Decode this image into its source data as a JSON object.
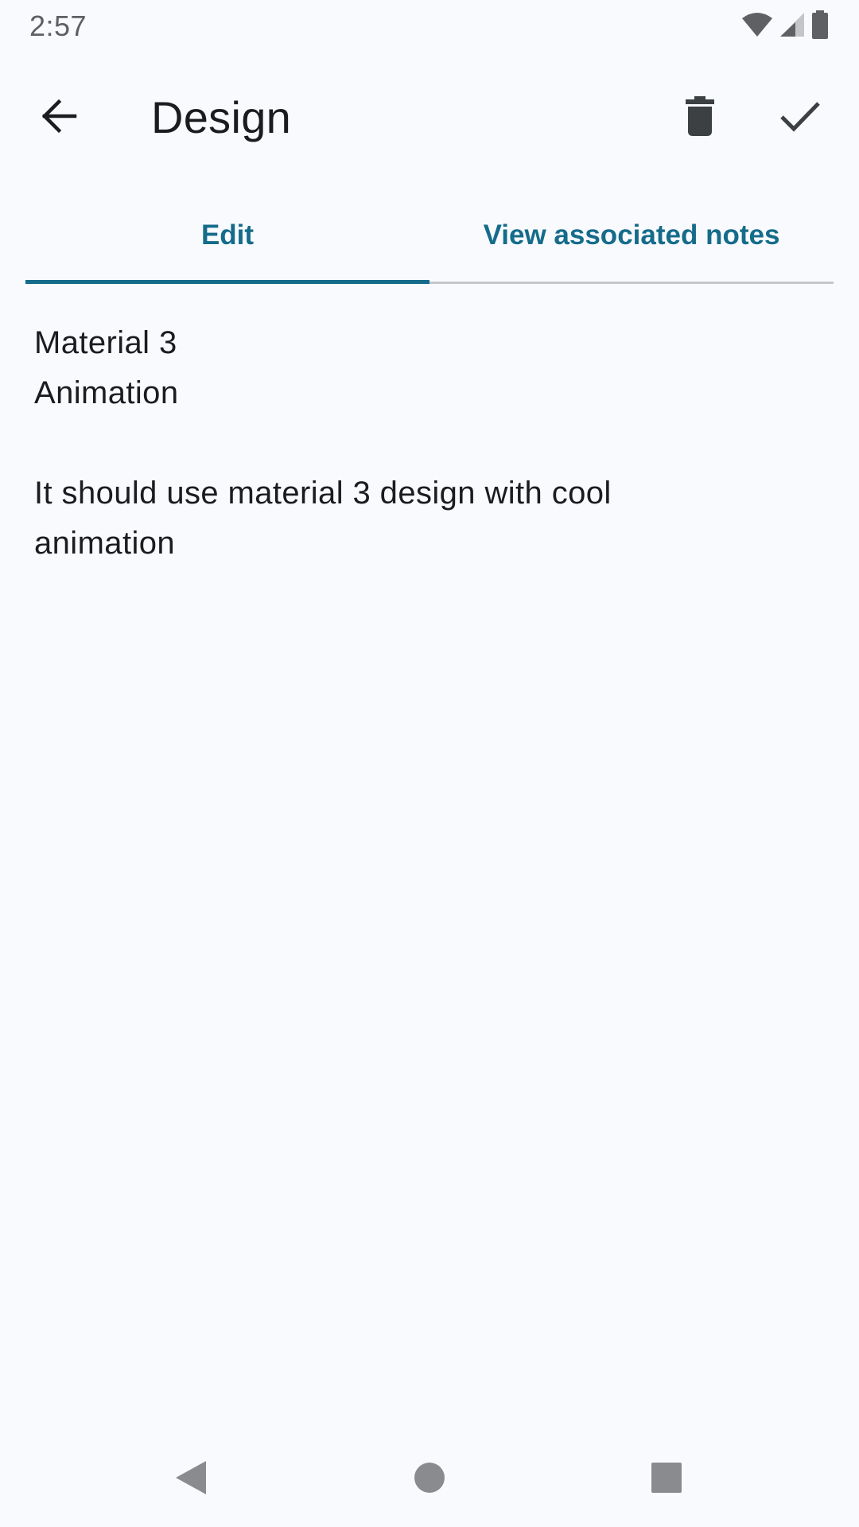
{
  "status_bar": {
    "time": "2:57",
    "icons": [
      "wifi-icon",
      "signal-icon",
      "battery-icon"
    ]
  },
  "app_bar": {
    "title": "Design",
    "back_icon": "arrow-left-icon",
    "delete_icon": "trash-icon",
    "save_icon": "check-icon"
  },
  "tabs": [
    {
      "label": "Edit",
      "selected": true
    },
    {
      "label": "View associated notes",
      "selected": false
    }
  ],
  "note": {
    "lines": [
      "Material 3",
      "Animation",
      "",
      "It should use material 3 design with cool",
      "animation"
    ]
  },
  "nav_bar": {
    "icons": [
      "nav-back-icon",
      "nav-home-icon",
      "nav-recents-icon"
    ]
  },
  "colors": {
    "background": "#F9FAFE",
    "accent": "#156C8A",
    "text": "#1B1C1E",
    "divider": "#C4C7CB"
  }
}
